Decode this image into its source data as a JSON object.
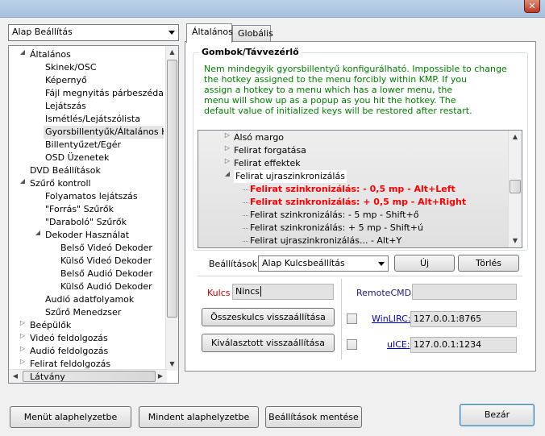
{
  "window": {
    "close_glyph": "✕"
  },
  "profile_combo": {
    "value": "Alap Beállítás"
  },
  "tree": {
    "items": [
      {
        "label": "Általános",
        "twisty": "◢"
      },
      {
        "label": "Skinek/OSC"
      },
      {
        "label": "Képernyő"
      },
      {
        "label": "Fájl megnyitás párbeszédablak"
      },
      {
        "label": "Lejátszás"
      },
      {
        "label": "Ismétlés/Lejátszólista"
      },
      {
        "label": "Gyorsbillentyűk/Általános Kontroll"
      },
      {
        "label": "Billentyűzet/Egér"
      },
      {
        "label": "OSD Üzenetek"
      },
      {
        "label": "DVD Beállítások"
      },
      {
        "label": "Szűrő kontroll",
        "twisty": "◢"
      },
      {
        "label": "Folyamatos lejátszás"
      },
      {
        "label": "\"Forrás\" Szűrők"
      },
      {
        "label": "\"Daraboló\" Szűrők"
      },
      {
        "label": "Dekoder Használat",
        "twisty": "◢"
      },
      {
        "label": "Belső Videó Dekoder"
      },
      {
        "label": "Külső Videó Dekoder"
      },
      {
        "label": "Belső Audió Dekoder"
      },
      {
        "label": "Külső Audió Dekoder"
      },
      {
        "label": "Audió adatfolyamok"
      },
      {
        "label": "Szűrő Menedzser"
      },
      {
        "label": "Beépülők",
        "twisty": "▷"
      },
      {
        "label": "Videó feldolgozás",
        "twisty": "▷"
      },
      {
        "label": "Audió feldolgozás",
        "twisty": "▷"
      },
      {
        "label": "Felirat feldolgozás",
        "twisty": "▷"
      },
      {
        "label": "Látvány"
      }
    ]
  },
  "tabs": [
    {
      "label": "Általános"
    },
    {
      "label": "Globális"
    }
  ],
  "group": {
    "title": "Gombok/Távvezérlő",
    "info": [
      "Nem mindegyik gyorsbillentyű konfigurálható. Impossible to change",
      "the hotkey assigned to the menu forcibly within KMP. If you",
      "assign a hotkey to a menu which has a lower menu, the",
      "menu will show up as a popup as you hit the hotkey. The",
      "default value of initialized keys will be restored after restart."
    ]
  },
  "hotkeys": {
    "items": [
      {
        "label": "Alsó margo",
        "twisty": "▷"
      },
      {
        "label": "Felirat forgatása",
        "twisty": "▷"
      },
      {
        "label": "Felirat effektek",
        "twisty": "▷"
      },
      {
        "label": "Felirat ujraszinkronizálás",
        "twisty": "◢"
      },
      {
        "label": "Felirat szinkronizálás: - 0,5 mp - Alt+Left"
      },
      {
        "label": "Felirat szinkronizálás: + 0,5 mp - Alt+Right"
      },
      {
        "label": "Felirat szinkronizálás: - 5 mp - Shift+ő"
      },
      {
        "label": "Felirat szinkronizálás: + 5 mp - Shift+ú"
      },
      {
        "label": "Felirat ujraszinkronizálás... - Alt+Y"
      }
    ]
  },
  "settings_row": {
    "label": "Beállítások:",
    "combo_value": "Alap Kulcsbeállítás",
    "new_label": "Új",
    "delete_label": "Törlés"
  },
  "key_row": {
    "label": "Kulcs",
    "value": "Nincs"
  },
  "remote": {
    "label": "RemoteCMD:",
    "value": ""
  },
  "reset_all_label": "Összeskulcs visszaállítása",
  "reset_selected_label": "Kiválasztott visszaállítása",
  "winlirc": {
    "label": "WinLIRC:",
    "value": "127.0.0.1:8765"
  },
  "uice": {
    "label": "uICE:",
    "value": "127.0.0.1:1234"
  },
  "footer": {
    "reset_menu_label": "Menüt alaphelyzetbe",
    "reset_all_label": "Mindent alaphelyzetbe",
    "save_label": "Beállítások mentése",
    "close_label": "Bezár"
  },
  "colors": {
    "info_text": "#008000",
    "hotkey_red": "#ff0000"
  }
}
